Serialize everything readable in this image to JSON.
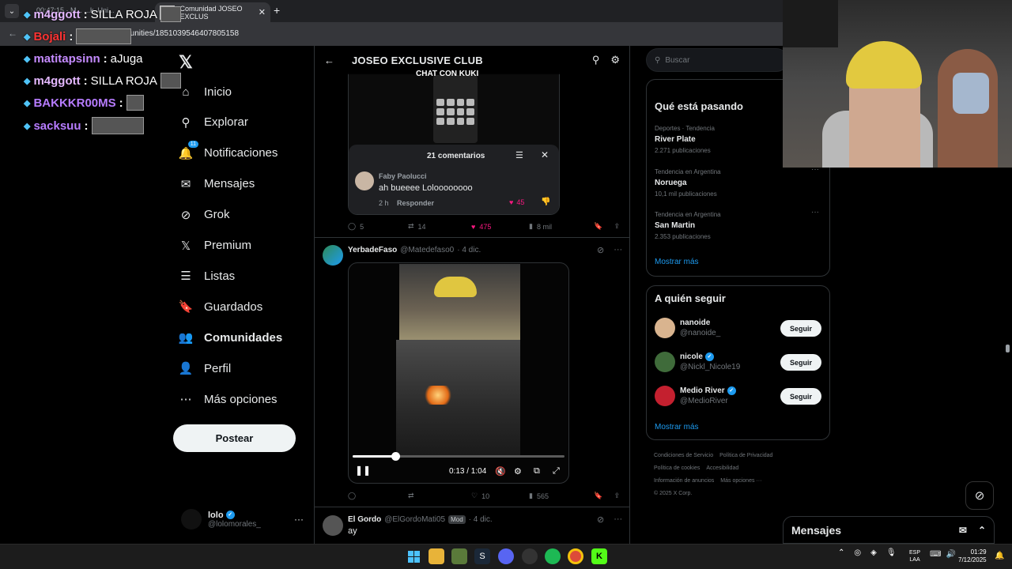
{
  "browser": {
    "tab_active_title": "Comunidad JOSEO EXCLUS",
    "tab_faint_text": "00:47:15 · M...  ...k..Uni...",
    "url": "mmunities/1851039546407805158",
    "new_tab": "+",
    "close_tab": "✕"
  },
  "chat": [
    {
      "user": "m4ggott",
      "text": "SILLA ROJA",
      "color": "#e4b8ff"
    },
    {
      "user": "Bojali",
      "text": "",
      "color": "#ff3333"
    },
    {
      "user": "matitapsinn",
      "text": "aJuga",
      "color": "#c58bff"
    },
    {
      "user": "m4ggott",
      "text": "SILLA ROJA",
      "color": "#e4b8ff"
    },
    {
      "user": "BAKKKR00MS",
      "text": "",
      "color": "#b77cff"
    },
    {
      "user": "sacksuu",
      "text": "",
      "color": "#b77cff"
    }
  ],
  "sidebar": {
    "logo": "𝕏",
    "items": [
      {
        "label": "Inicio",
        "icon": "home-icon",
        "glyph": "⌂"
      },
      {
        "label": "Explorar",
        "icon": "search-icon",
        "glyph": "⚲"
      },
      {
        "label": "Notificaciones",
        "icon": "bell-icon",
        "glyph": "🔔",
        "badge": "11"
      },
      {
        "label": "Mensajes",
        "icon": "mail-icon",
        "glyph": "✉"
      },
      {
        "label": "Grok",
        "icon": "grok-icon",
        "glyph": "⊘"
      },
      {
        "label": "Premium",
        "icon": "x-icon",
        "glyph": "𝕏"
      },
      {
        "label": "Listas",
        "icon": "list-icon",
        "glyph": "☰"
      },
      {
        "label": "Guardados",
        "icon": "bookmark-icon",
        "glyph": "🔖"
      },
      {
        "label": "Comunidades",
        "icon": "communities-icon",
        "glyph": "👥"
      },
      {
        "label": "Perfil",
        "icon": "profile-icon",
        "glyph": "👤"
      },
      {
        "label": "Más opciones",
        "icon": "more-icon",
        "glyph": "⋯"
      }
    ],
    "post_button": "Postear",
    "account": {
      "name": "lolo",
      "handle": "@lolomorales_",
      "more": "···"
    }
  },
  "community": {
    "title": "JOSEO EXCLUSIVE CLUB",
    "overlay_caption": "CHAT CON KUKI"
  },
  "post1": {
    "comments_panel": {
      "title": "21 comentarios",
      "comment_author": "Faby Paolucci",
      "comment_text": "ah bueeee Loloooooooo",
      "comment_time": "2 h",
      "reply": "Responder",
      "likes": "45"
    },
    "actions": {
      "replies": "5",
      "reposts": "14",
      "likes": "475",
      "views": "8 mil"
    }
  },
  "post2": {
    "name": "YerbadeFaso",
    "handle": "@Matedefaso0",
    "date": "· 4 dic.",
    "video": {
      "time": "0:13 / 1:04",
      "progress": 0.2
    },
    "actions": {
      "replies": "",
      "reposts": "",
      "likes": "10",
      "views": "565"
    }
  },
  "post3": {
    "name": "El Gordo",
    "handle": "@ElGordoMati05",
    "badge": "Mod",
    "date": "· 4 dic.",
    "text": "ay"
  },
  "right": {
    "search_placeholder": "Buscar",
    "trends_title": "Qué está pasando",
    "trends": [
      {
        "meta": "Deportes · Tendencia",
        "name": "River Plate",
        "count": "2.271 publicaciones"
      },
      {
        "meta": "Tendencia en Argentina",
        "name": "Noruega",
        "count": "10,1 mil publicaciones"
      },
      {
        "meta": "Tendencia en Argentina",
        "name": "San Martin",
        "count": "2.353 publicaciones"
      }
    ],
    "trends_more": "Mostrar más",
    "follow_title": "A quién seguir",
    "follow": [
      {
        "name": "nanoide",
        "handle": "@nanoide_",
        "verified": false,
        "button": "Seguir",
        "color": "#d9b48f"
      },
      {
        "name": "nicole",
        "handle": "@Nickl_Nicole19",
        "verified": true,
        "button": "Seguir",
        "color": "#3f6b3a"
      },
      {
        "name": "Medio River",
        "handle": "@MedioRiver",
        "verified": true,
        "button": "Seguir",
        "color": "#c4202f"
      }
    ],
    "follow_more": "Mostrar más",
    "footer": [
      [
        "Condiciones de Servicio",
        "Política de Privacidad"
      ],
      [
        "Política de cookies",
        "Accesibilidad"
      ],
      [
        "Información de anuncios",
        "Más opciones ···"
      ],
      [
        "© 2025 X Corp."
      ]
    ]
  },
  "messages_drawer": {
    "title": "Mensajes"
  },
  "taskbar": {
    "lang_top": "ESP",
    "lang_bottom": "LAA",
    "time": "01:29",
    "date": "7/12/2025"
  }
}
